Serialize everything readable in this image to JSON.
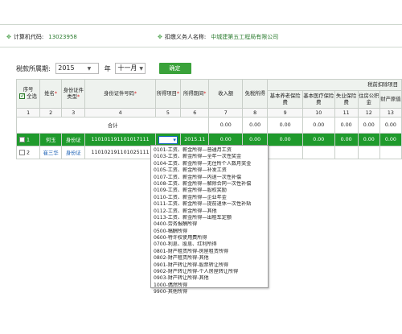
{
  "header": {
    "taxpayer_label": "计算机代码:",
    "taxpayer_code": "13023958",
    "withholder_label": "扣缴义务人名称:",
    "withholder_name": "中城建第五工程局有限公司"
  },
  "period": {
    "label": "税款所属期:",
    "year": "2015",
    "year_unit": "年",
    "month": "十一月",
    "confirm_label": "确定"
  },
  "table": {
    "headers": {
      "seq": "序号",
      "select_all": "全选",
      "name": "姓名",
      "id_type": "身份证件类型",
      "id_no": "身份证件号码",
      "income_item": "所得项目",
      "income_period": "所得期间",
      "income_amount": "收入额",
      "tax_exempt": "免税所得",
      "deduction_group": "税前扣除项目",
      "pension": "基本养老保险费",
      "medical": "基本医疗保险费",
      "unemployment": "失业保险费",
      "housing_fund": "住房公积金",
      "property": "财产原值"
    },
    "col_numbers": [
      "1",
      "2",
      "3",
      "4",
      "5",
      "6",
      "7",
      "8",
      "9",
      "10",
      "11",
      "12",
      "13"
    ],
    "total_label": "合计",
    "totals": [
      "0.00",
      "0.00",
      "0.00",
      "0.00",
      "0.00",
      "0.00",
      "0.00"
    ],
    "rows": [
      {
        "seq": "1",
        "name": "何玉",
        "id_type": "身份证",
        "id_no": "110101191101017111",
        "income_period": "2015.11",
        "values": [
          "0.00",
          "0.00",
          "0.00",
          "0.00",
          "0.00",
          "0.00",
          "0.00"
        ]
      },
      {
        "seq": "2",
        "name": "崔三华",
        "id_type": "身份证",
        "id_no": "110102191101025111",
        "income_period": "",
        "values": [
          "",
          "",
          "",
          "",
          "",
          "",
          ""
        ]
      }
    ]
  },
  "income_dropdown": {
    "options": [
      "0101-工资、薪金所得—普通月工资",
      "0103-工资、薪金所得—全年一次性奖金",
      "0104-工资、薪金所得—无住所个人数月奖金",
      "0105-工资、薪金所得—补发工资",
      "0107-工资、薪金所得—内退一次性补偿",
      "0108-工资、薪金所得—解除合同一次性补偿",
      "0109-工资、薪金所得—股权奖励",
      "0110-工资、薪金所得—企业年金",
      "0111-工资、薪金所得—提前退休一次性补贴",
      "0112-工资、薪金所得—其他",
      "0113-工资、薪金所得—出租车定额",
      "0400-劳务报酬所得",
      "0500-稿酬所得",
      "0600-特许权使用费所得",
      "0700-利息、股息、红利所得",
      "0801-财产租赁所得-房屋租赁所得",
      "0802-财产租赁所得-其他",
      "0901-财产转让所得-股票转让所得",
      "0902-财产转让所得-个人房屋转让所得",
      "0903-财产转让所得-其他",
      "1000-偶然所得",
      "9900-其他所得"
    ]
  }
}
